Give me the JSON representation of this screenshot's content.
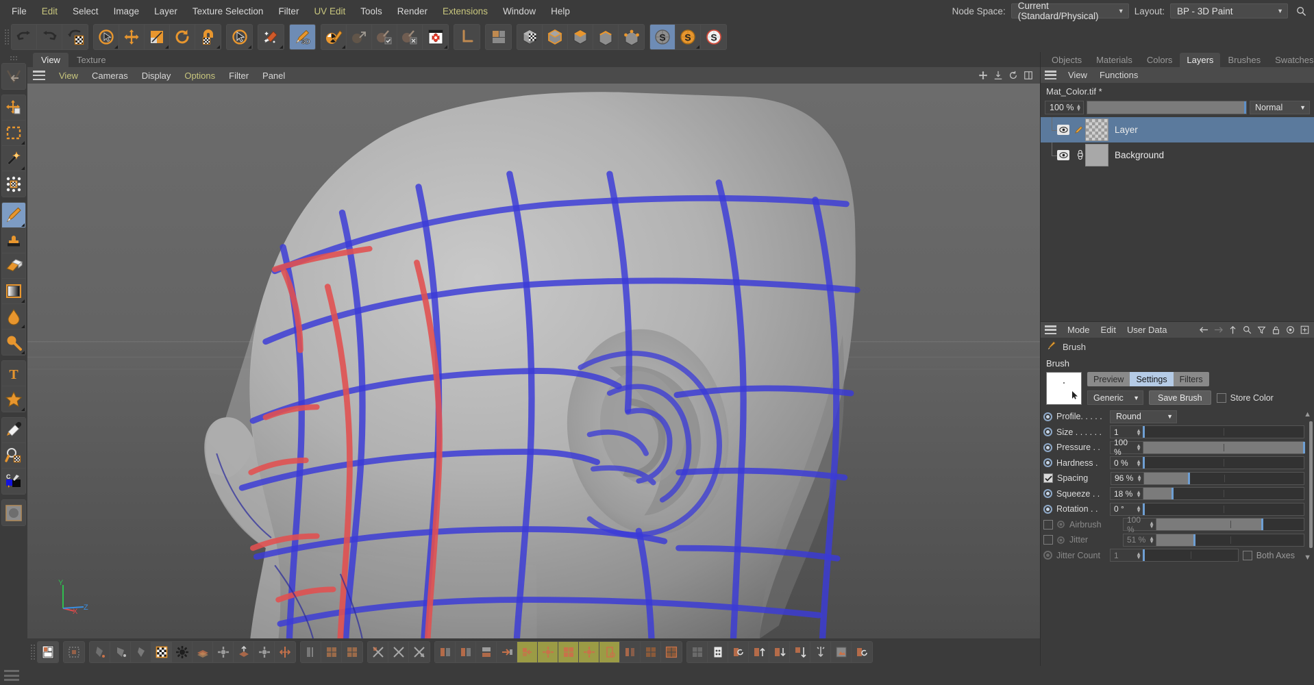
{
  "menubar": {
    "items": [
      {
        "label": "File",
        "style": "plain"
      },
      {
        "label": "Edit",
        "style": "olive"
      },
      {
        "label": "Select",
        "style": "plain"
      },
      {
        "label": "Image",
        "style": "plain"
      },
      {
        "label": "Layer",
        "style": "plain"
      },
      {
        "label": "Texture Selection",
        "style": "plain"
      },
      {
        "label": "Filter",
        "style": "plain"
      },
      {
        "label": "UV Edit",
        "style": "olive"
      },
      {
        "label": "Tools",
        "style": "plain"
      },
      {
        "label": "Render",
        "style": "plain"
      },
      {
        "label": "Extensions",
        "style": "olive"
      },
      {
        "label": "Window",
        "style": "plain"
      },
      {
        "label": "Help",
        "style": "plain"
      }
    ],
    "node_space_label": "Node Space:",
    "node_space_value": "Current (Standard/Physical)",
    "layout_label": "Layout:",
    "layout_value": "BP - 3D Paint"
  },
  "toolbar": {
    "groups": [
      {
        "buttons": [
          {
            "name": "undo-icon",
            "icon": "undo"
          },
          {
            "name": "redo-icon",
            "icon": "redo"
          },
          {
            "name": "undo-texture-icon",
            "icon": "undo-tex"
          }
        ]
      },
      {
        "buttons": [
          {
            "name": "live-selection-icon",
            "icon": "cursor-circle",
            "corner": true
          },
          {
            "name": "move-tool-icon",
            "icon": "move"
          },
          {
            "name": "scale-tool-icon",
            "icon": "scale",
            "corner": true
          },
          {
            "name": "rotate-tool-icon",
            "icon": "rotate"
          },
          {
            "name": "magnet-tool-icon",
            "icon": "magnet",
            "corner": true
          }
        ]
      },
      {
        "buttons": [
          {
            "name": "selection-tool-icon",
            "icon": "cursor-circle2",
            "corner": true
          }
        ]
      },
      {
        "buttons": [
          {
            "name": "paint-setup-wizard-icon",
            "icon": "wizard",
            "corner": true
          }
        ]
      },
      {
        "buttons": [
          {
            "name": "paint-3d-toggle-icon",
            "icon": "brush3d",
            "selected": true
          }
        ]
      },
      {
        "buttons": [
          {
            "name": "paintable-object-icon",
            "icon": "sphere-brush",
            "corner": true
          },
          {
            "name": "deselect-paintable-icon",
            "icon": "sphere-arrow"
          },
          {
            "name": "enable-texture-icon",
            "icon": "sphere-check"
          },
          {
            "name": "disable-texture-icon",
            "icon": "sphere-x"
          },
          {
            "name": "projection-paint-icon",
            "icon": "projpaint",
            "corner": true
          }
        ]
      },
      {
        "buttons": [
          {
            "name": "axis-tool-icon",
            "icon": "axisL"
          }
        ]
      },
      {
        "buttons": [
          {
            "name": "layout-tool-icon",
            "icon": "layoutsq"
          }
        ]
      },
      {
        "buttons": [
          {
            "name": "uv-polygon-mode-icon",
            "icon": "cube-checker"
          },
          {
            "name": "object-mode-icon",
            "icon": "cube-outline"
          },
          {
            "name": "polygon-mode-icon",
            "icon": "cube-top"
          },
          {
            "name": "edge-mode-icon",
            "icon": "cube-edge"
          },
          {
            "name": "point-mode-icon",
            "icon": "cube-point"
          }
        ]
      },
      {
        "buttons": [
          {
            "name": "symmetry-off-icon",
            "icon": "s-gray",
            "selected": true
          },
          {
            "name": "symmetry-orange-icon",
            "icon": "s-orange",
            "corner": true
          },
          {
            "name": "symmetry-white-icon",
            "icon": "s-white"
          }
        ]
      }
    ]
  },
  "left_tools": {
    "groups": [
      {
        "buttons": [
          {
            "name": "back-arrow-tool-icon",
            "icon": "backarrow"
          }
        ]
      },
      {
        "buttons": [
          {
            "name": "move-tool-icon",
            "icon": "move-layer"
          },
          {
            "name": "rectangle-select-icon",
            "icon": "rect-select",
            "corner": true
          },
          {
            "name": "magic-wand-icon",
            "icon": "wand",
            "corner": true
          },
          {
            "name": "transform-tool-icon",
            "icon": "transform"
          }
        ]
      },
      {
        "buttons": [
          {
            "name": "brush-tool-icon",
            "icon": "brush",
            "selected": true,
            "corner": true
          },
          {
            "name": "clone-stamp-icon",
            "icon": "stamp"
          },
          {
            "name": "eraser-tool-icon",
            "icon": "eraser"
          },
          {
            "name": "gradient-tool-icon",
            "icon": "gradient",
            "corner": true
          },
          {
            "name": "fill-tool-icon",
            "icon": "droplet",
            "corner": true
          },
          {
            "name": "blur-tool-icon",
            "icon": "blur",
            "corner": true
          }
        ]
      },
      {
        "buttons": [
          {
            "name": "text-tool-icon",
            "icon": "text"
          },
          {
            "name": "shape-tool-icon",
            "icon": "star",
            "corner": true
          }
        ]
      },
      {
        "buttons": [
          {
            "name": "color-picker-icon",
            "icon": "eyedropper"
          },
          {
            "name": "zoom-tool-icon",
            "icon": "zoomtex"
          },
          {
            "name": "color-swatch",
            "icon": "swatch"
          }
        ]
      },
      {
        "buttons": [
          {
            "name": "brush-preview",
            "icon": "brushpreview"
          }
        ]
      }
    ]
  },
  "viewport": {
    "tabs": [
      {
        "label": "View",
        "active": true
      },
      {
        "label": "Texture",
        "active": false
      }
    ],
    "menu": [
      {
        "label": "View",
        "style": "olive"
      },
      {
        "label": "Cameras",
        "style": "plain"
      },
      {
        "label": "Display",
        "style": "plain"
      },
      {
        "label": "Options",
        "style": "olive"
      },
      {
        "label": "Filter",
        "style": "plain"
      },
      {
        "label": "Panel",
        "style": "plain"
      }
    ],
    "axis": {
      "x": "X",
      "y": "Y",
      "z": "Z"
    }
  },
  "bottom_tools": {
    "groups": [
      {
        "buttons": [
          {
            "name": "uv-mesh-toggle-icon",
            "icon": "b-uvmesh",
            "sel": true
          }
        ]
      },
      {
        "buttons": [
          {
            "name": "uv-points-icon",
            "icon": "b-uvpoints"
          }
        ]
      },
      {
        "buttons": [
          {
            "name": "uv-polygon-red-icon",
            "icon": "b-poly1"
          },
          {
            "name": "uv-polygon-gray-icon",
            "icon": "b-poly2"
          },
          {
            "name": "uv-polygon-small-icon",
            "icon": "b-poly3"
          },
          {
            "name": "texture-view-icon",
            "icon": "b-checker",
            "sel": true
          },
          {
            "name": "texture-settings-icon",
            "icon": "b-gear"
          },
          {
            "name": "uv-layers-icon",
            "icon": "b-stack"
          },
          {
            "name": "uv-layers-gear-icon",
            "icon": "b-gear2"
          },
          {
            "name": "uv-project-icon",
            "icon": "b-proj"
          },
          {
            "name": "uv-project-gear-icon",
            "icon": "b-gear3"
          },
          {
            "name": "uv-mirror-icon",
            "icon": "b-mirror"
          }
        ]
      },
      {
        "buttons": [
          {
            "name": "uv-flip-icon",
            "icon": "b-flip"
          },
          {
            "name": "uv-checker-a-icon",
            "icon": "b-chka"
          },
          {
            "name": "uv-checker-b-icon",
            "icon": "b-chkb"
          }
        ]
      },
      {
        "buttons": [
          {
            "name": "uv-relax-a-icon",
            "icon": "b-relaxa"
          },
          {
            "name": "uv-relax-b-icon",
            "icon": "b-relaxb"
          },
          {
            "name": "uv-relax-c-icon",
            "icon": "b-relaxc"
          }
        ]
      },
      {
        "buttons": [
          {
            "name": "uv-align-a-icon",
            "icon": "b-aligna"
          },
          {
            "name": "uv-align-b-icon",
            "icon": "b-alignb"
          },
          {
            "name": "uv-align-c-icon",
            "icon": "b-alignc"
          },
          {
            "name": "uv-align-d-icon",
            "icon": "b-alignd"
          },
          {
            "name": "uv-align-e-icon",
            "icon": "b-aligne",
            "hl": true
          },
          {
            "name": "uv-align-f-icon",
            "icon": "b-alignf",
            "hl": true
          },
          {
            "name": "uv-align-g-icon",
            "icon": "b-aligng",
            "hl": true
          },
          {
            "name": "uv-align-h-icon",
            "icon": "b-alignh",
            "hl": true
          },
          {
            "name": "uv-align-i-icon",
            "icon": "b-aligni",
            "hl": true
          },
          {
            "name": "uv-align-j-icon",
            "icon": "b-alignj"
          },
          {
            "name": "uv-align-k-icon",
            "icon": "b-alignk"
          },
          {
            "name": "uv-align-l-icon",
            "icon": "b-alignl"
          }
        ]
      },
      {
        "buttons": [
          {
            "name": "uv-grid-icon",
            "icon": "b-grid"
          },
          {
            "name": "uv-calc-icon",
            "icon": "b-calc"
          },
          {
            "name": "uv-rotate-icon",
            "icon": "b-rot"
          },
          {
            "name": "uv-up-icon",
            "icon": "b-up"
          },
          {
            "name": "uv-down-icon",
            "icon": "b-down"
          },
          {
            "name": "uv-dist-icon",
            "icon": "b-dist"
          },
          {
            "name": "uv-center-icon",
            "icon": "b-center"
          },
          {
            "name": "uv-image-icon",
            "icon": "b-image"
          },
          {
            "name": "uv-recalc-icon",
            "icon": "b-recalc"
          }
        ]
      }
    ]
  },
  "layers_panel": {
    "tabs": [
      {
        "label": "Objects",
        "active": false
      },
      {
        "label": "Materials",
        "active": false
      },
      {
        "label": "Colors",
        "active": false
      },
      {
        "label": "Layers",
        "active": true
      },
      {
        "label": "Brushes",
        "active": false
      },
      {
        "label": "Swatches",
        "active": false
      }
    ],
    "menu": [
      "View",
      "Functions"
    ],
    "filename": "Mat_Color.tif *",
    "opacity": "100 %",
    "opacity_pct": 100,
    "blend_mode": "Normal",
    "layers": [
      {
        "name": "Layer",
        "selected": true,
        "thumb": "checker",
        "mark": "pencil-icon",
        "visible": true
      },
      {
        "name": "Background",
        "selected": false,
        "thumb": "flat",
        "mark": "link-icon",
        "visible": true
      }
    ]
  },
  "attributes": {
    "menu": [
      "Mode",
      "Edit",
      "User Data"
    ],
    "nav_icons": [
      "back-arrow-icon",
      "forward-arrow-icon",
      "up-arrow-icon",
      "search-icon",
      "filter-icon",
      "lock-icon",
      "target-icon",
      "add-icon"
    ],
    "object_name": "Brush",
    "object_icon": "brush-icon",
    "section_title": "Brush",
    "tabs": [
      {
        "label": "Preview",
        "active": false
      },
      {
        "label": "Settings",
        "active": true
      },
      {
        "label": "Filters",
        "active": false
      }
    ],
    "preset": "Generic",
    "save_button": "Save Brush",
    "store_color_label": "Store Color",
    "store_color_checked": false,
    "params": [
      {
        "label": "Profile. . . . .",
        "type": "select",
        "value": "Round",
        "control": "radio",
        "enabled": true
      },
      {
        "label": "Size  . . . . . .",
        "type": "slider",
        "value": "1",
        "pct": 0,
        "control": "radio",
        "enabled": true
      },
      {
        "label": "Pressure . .",
        "type": "slider",
        "value": "100 %",
        "pct": 100,
        "control": "radio",
        "enabled": true
      },
      {
        "label": "Hardness .",
        "type": "slider",
        "value": "0 %",
        "pct": 0,
        "control": "radio",
        "enabled": true
      },
      {
        "label": "Spacing",
        "type": "slider",
        "value": "96 %",
        "pct": 28,
        "control": "checkbox",
        "checked": true,
        "enabled": true
      },
      {
        "label": "Squeeze . .",
        "type": "slider",
        "value": "18 %",
        "pct": 18,
        "control": "radio",
        "enabled": true
      },
      {
        "label": "Rotation . .",
        "type": "slider",
        "value": "0 °",
        "pct": 0,
        "control": "radio",
        "enabled": true
      },
      {
        "label": "Airbrush",
        "type": "slider",
        "value": "100 %",
        "pct": 72,
        "control": "checkbox-radio",
        "checked": false,
        "enabled": false
      },
      {
        "label": "Jitter",
        "type": "slider",
        "value": "51 %",
        "pct": 26,
        "control": "checkbox-radio",
        "checked": false,
        "enabled": false
      },
      {
        "label": "Jitter Count",
        "type": "slider",
        "value": "1",
        "pct": 0,
        "control": "radio",
        "enabled": false,
        "extra_checkbox": "Both Axes",
        "extra_checked": false
      }
    ]
  }
}
